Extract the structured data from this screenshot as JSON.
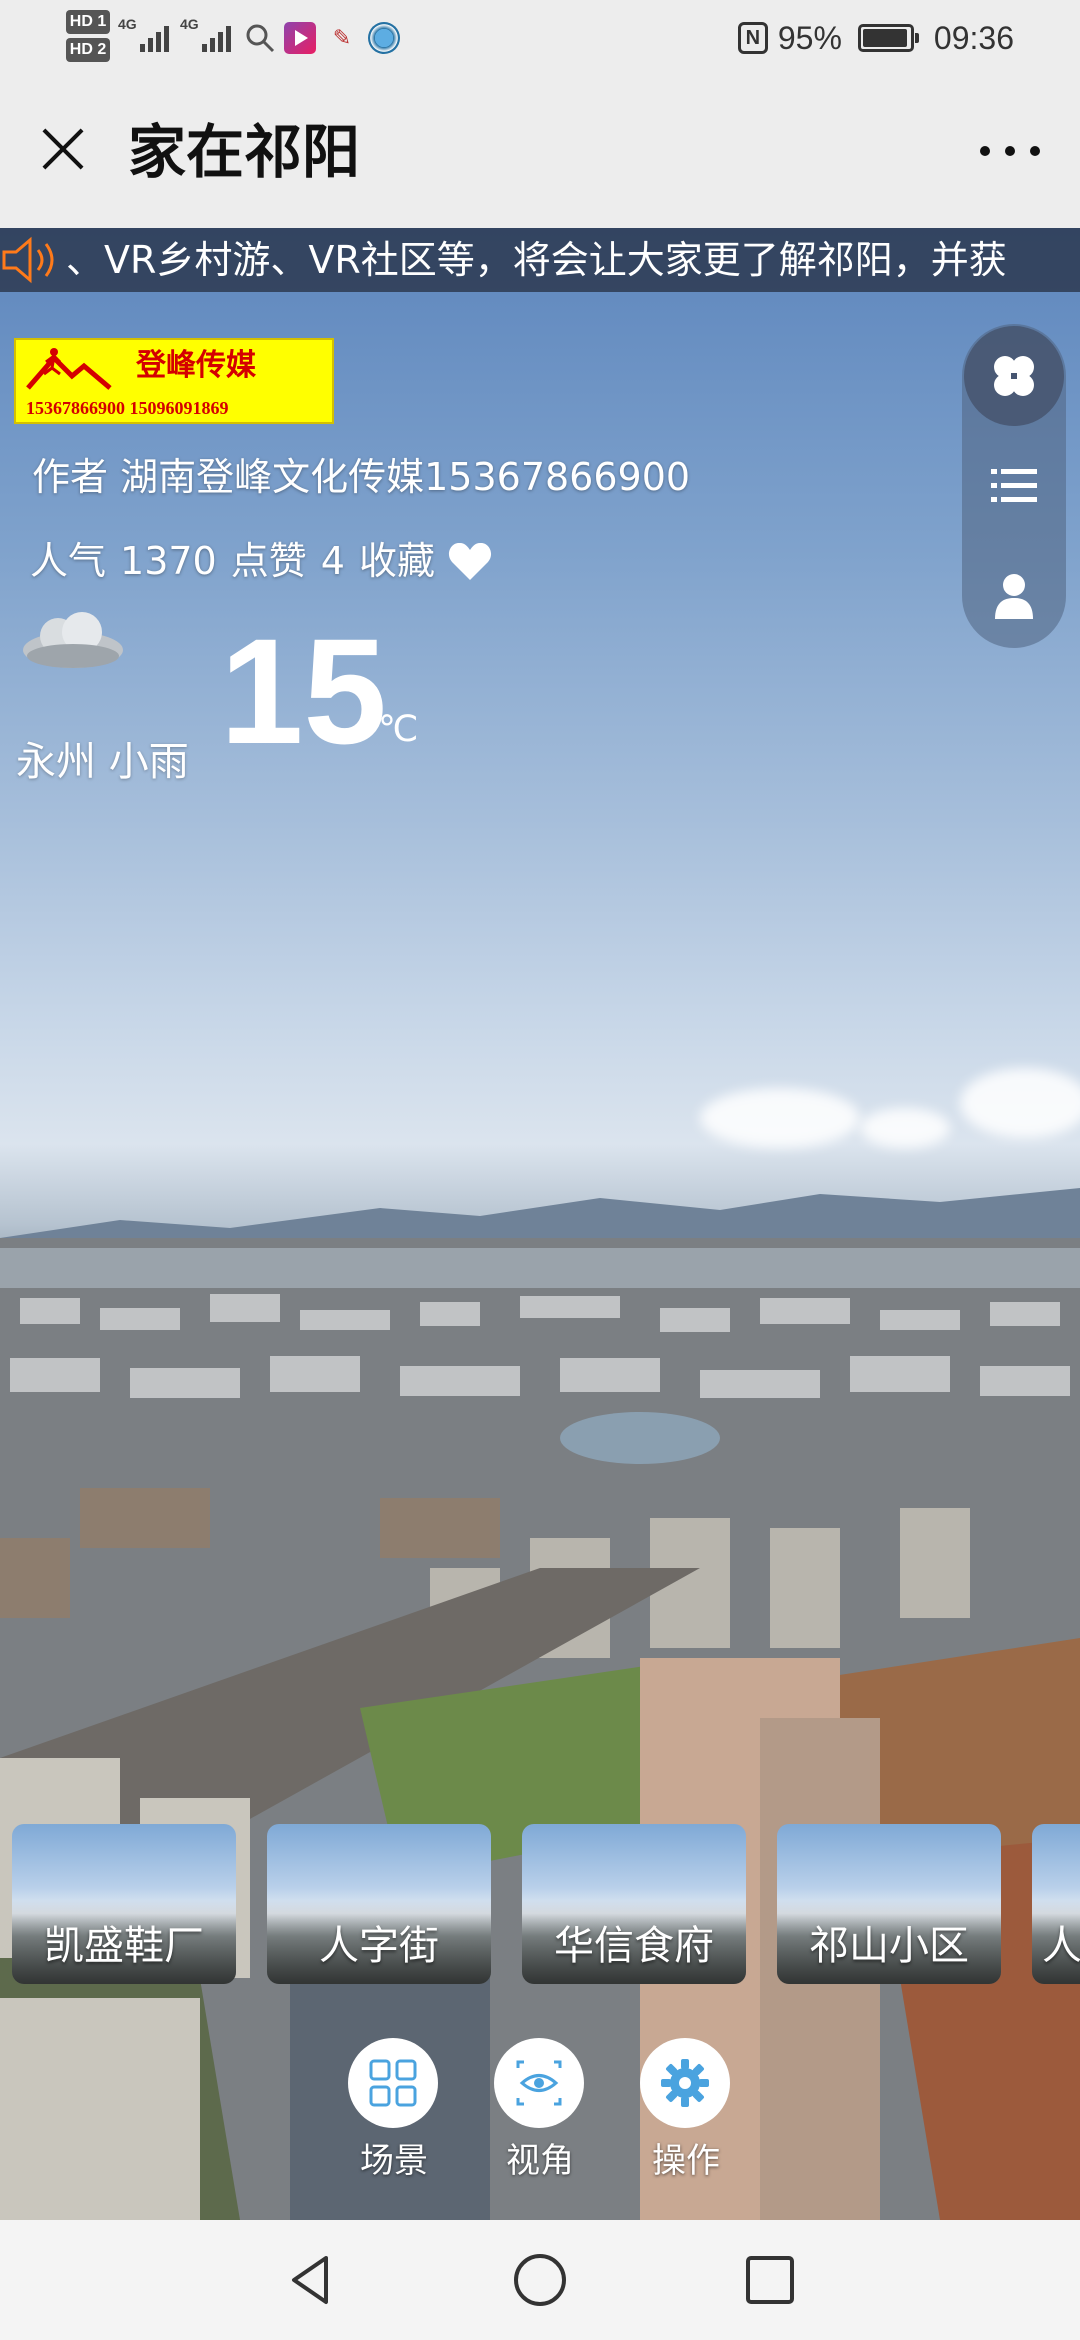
{
  "status_bar": {
    "hd1": "HD 1",
    "hd2": "HD 2",
    "signal1": "4G",
    "signal2": "4G",
    "battery": "95%",
    "time": "09:36",
    "icons": [
      "search-icon",
      "video-app-icon",
      "study-app-icon",
      "browser-icon",
      "nfc-icon",
      "battery-icon"
    ]
  },
  "header": {
    "title": "家在祁阳",
    "icons": [
      "close-icon",
      "more-icon"
    ]
  },
  "marquee": {
    "text": "、VR乡村游、VR社区等，将会让大家更了解祁阳，并获",
    "icon": "speaker-icon"
  },
  "logo": {
    "name": "登峰传媒",
    "phones": "15367866900  15096091869"
  },
  "author": {
    "label": "作者",
    "name": "湖南登峰文化传媒15367866900"
  },
  "stats": {
    "views_label": "人气",
    "views": "1370",
    "likes_label": "点赞",
    "likes": "4",
    "favorite_label": "收藏"
  },
  "weather": {
    "city": "永州",
    "condition": "小雨",
    "temp": "15",
    "unit": "℃",
    "icon": "cloud-icon"
  },
  "side_menu": {
    "icons": [
      "clover-icon",
      "list-icon",
      "user-icon"
    ]
  },
  "scenes": [
    {
      "label": "凯盛鞋厂"
    },
    {
      "label": "人字街"
    },
    {
      "label": "华信食府"
    },
    {
      "label": "祁山小区"
    },
    {
      "label": "人"
    }
  ],
  "toolbar": {
    "scene_label": "场景",
    "view_label": "视角",
    "operate_label": "操作"
  },
  "nav": {
    "icons": [
      "back-icon",
      "home-icon",
      "recents-icon"
    ]
  },
  "colors": {
    "accent": "#4aa3df",
    "logo_bg": "#ffff00",
    "logo_text": "#d40000",
    "bar_bg": "#ededed"
  }
}
